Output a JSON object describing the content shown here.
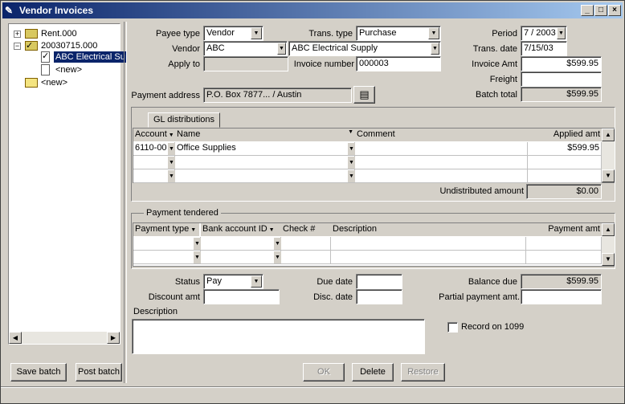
{
  "window": {
    "title": "Vendor Invoices"
  },
  "tree": {
    "nodes": [
      {
        "label": "Rent.000",
        "expander": "+"
      },
      {
        "label": "20030715.000",
        "expander": "−"
      },
      {
        "label": "ABC Electrical Su"
      },
      {
        "label": "<new>"
      },
      {
        "label": "<new>"
      }
    ]
  },
  "left_buttons": {
    "save": "Save batch",
    "post": "Post batch"
  },
  "form": {
    "payee_type_label": "Payee type",
    "payee_type": "Vendor",
    "trans_type_label": "Trans. type",
    "trans_type": "Purchase",
    "period_label": "Period",
    "period": "7 / 2003",
    "vendor_label": "Vendor",
    "vendor_id": "ABC",
    "vendor_name": "ABC Electrical Supply",
    "trans_date_label": "Trans. date",
    "trans_date": "7/15/03",
    "apply_to_label": "Apply to",
    "apply_to": "",
    "invoice_number_label": "Invoice number",
    "invoice_number": "000003",
    "invoice_amt_label": "Invoice Amt",
    "invoice_amt": "$599.95",
    "freight_label": "Freight",
    "freight": "",
    "payment_address_label": "Payment address",
    "payment_address": "P.O. Box 7877... / Austin",
    "batch_total_label": "Batch total",
    "batch_total": "$599.95"
  },
  "gl": {
    "tab": "GL distributions",
    "headers": {
      "account": "Account",
      "name": "Name",
      "comment": "Comment",
      "applied_amt": "Applied amt"
    },
    "rows": [
      {
        "account": "6110-00",
        "name": "Office Supplies",
        "comment": "",
        "amt": "$599.95"
      },
      {
        "account": "",
        "name": "",
        "comment": "",
        "amt": ""
      },
      {
        "account": "",
        "name": "",
        "comment": "",
        "amt": ""
      }
    ],
    "undistributed_label": "Undistributed amount",
    "undistributed": "$0.00"
  },
  "payment": {
    "group_label": "Payment tendered",
    "headers": {
      "type": "Payment type",
      "bank": "Bank account ID",
      "check": "Check #",
      "desc": "Description",
      "amt": "Payment amt"
    }
  },
  "bottom": {
    "status_label": "Status",
    "status": "Pay",
    "due_date_label": "Due date",
    "due_date": "",
    "balance_due_label": "Balance due",
    "balance_due": "$599.95",
    "discount_amt_label": "Discount amt",
    "discount_amt": "",
    "disc_date_label": "Disc. date",
    "disc_date": "",
    "partial_payment_label": "Partial payment amt.",
    "partial_payment": "",
    "description_label": "Description",
    "description": "",
    "record_1099_label": "Record on 1099"
  },
  "actions": {
    "ok": "OK",
    "delete": "Delete",
    "restore": "Restore"
  }
}
